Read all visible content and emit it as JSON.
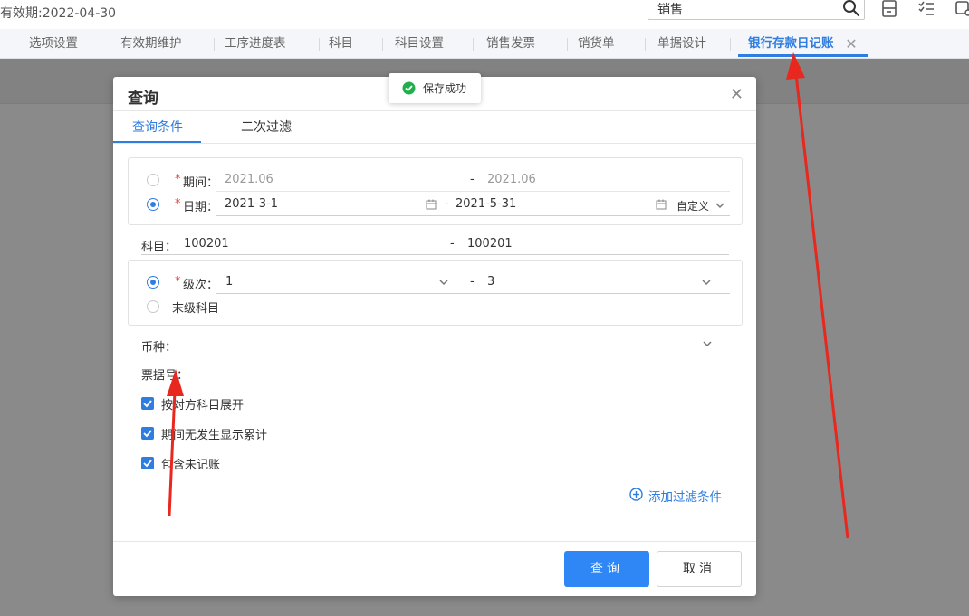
{
  "header": {
    "expiry_text": "有效期:2022-04-30",
    "search_value": "销售",
    "icons": [
      "search-icon",
      "calculator-icon",
      "checklist-icon",
      "settings-icon"
    ]
  },
  "tabs": [
    {
      "label": "选项设置",
      "active": false
    },
    {
      "label": "有效期维护",
      "active": false
    },
    {
      "label": "工序进度表",
      "active": false
    },
    {
      "label": "科目",
      "active": false
    },
    {
      "label": "科目设置",
      "active": false
    },
    {
      "label": "销售发票",
      "active": false
    },
    {
      "label": "销货单",
      "active": false
    },
    {
      "label": "单据设计",
      "active": false
    },
    {
      "label": "银行存款日记账",
      "active": true,
      "closable": true
    }
  ],
  "toast": {
    "message": "保存成功",
    "icon": "check-circle-icon"
  },
  "dialog": {
    "title": "查询",
    "tabs": [
      {
        "label": "查询条件",
        "active": true
      },
      {
        "label": "二次过滤",
        "active": false
      }
    ],
    "period": {
      "required_mark": "*",
      "label": "期间：",
      "from": "2021.06",
      "to": "2021.06",
      "selected": false
    },
    "date": {
      "required_mark": "*",
      "label": "日期：",
      "from": "2021-3-1",
      "to": "2021-5-31",
      "preset": "自定义",
      "selected": true
    },
    "subject": {
      "label": "科目：",
      "from": "100201",
      "to": "100201"
    },
    "level": {
      "required_mark": "*",
      "label": "级次：",
      "from": "1",
      "to": "3",
      "selected": true
    },
    "last_level": {
      "label": "末级科目",
      "selected": false
    },
    "currency": {
      "label": "币种：",
      "value": ""
    },
    "bill_no": {
      "label": "票据号：",
      "value": ""
    },
    "checkboxes": [
      {
        "label": "按对方科目展开",
        "checked": true
      },
      {
        "label": "期间无发生显示累计",
        "checked": true
      },
      {
        "label": "包含未记账",
        "checked": true
      }
    ],
    "add_filter_label": "添加过滤条件",
    "query_button": "查询",
    "cancel_button": "取消"
  },
  "colors": {
    "accent": "#2f7de1",
    "primary_button": "#2f87f5",
    "required": "#e23b3b",
    "overlay": "#8a8a8a",
    "annotation": "#e8281e"
  }
}
